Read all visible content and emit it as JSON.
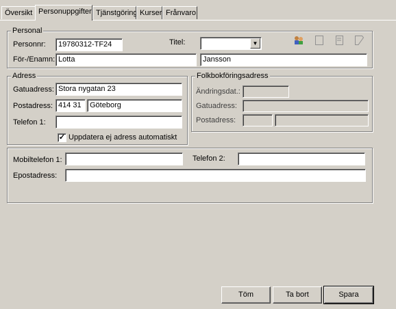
{
  "tabs": [
    {
      "label": "Översikt",
      "active": false
    },
    {
      "label": "Personuppgifter",
      "active": true
    },
    {
      "label": "Tjänstgöring",
      "active": false
    },
    {
      "label": "Kurser",
      "active": false
    },
    {
      "label": "Frånvaro",
      "active": false
    }
  ],
  "personal": {
    "legend": "Personal",
    "personnr_label": "Personnr:",
    "personnr_value": "19780312-TF24",
    "titel_label": "Titel:",
    "titel_value": "",
    "name_label": "För-/Enamn:",
    "first_name": "Lotta",
    "last_name": "Jansson",
    "toolbar_icons": [
      "people-icon",
      "blank-page-icon",
      "document-icon",
      "note-icon"
    ]
  },
  "adress": {
    "legend": "Adress",
    "gatuadress_label": "Gatuadress:",
    "gatuadress_value": "Stora nygatan 23",
    "postadress_label": "Postadress:",
    "postnummer_value": "414 31",
    "postort_value": "Göteborg",
    "telefon1_label": "Telefon 1:",
    "telefon1_value": "",
    "checkbox_label": "Uppdatera ej adress automatiskt",
    "checkbox_checked": true
  },
  "folkbokforing": {
    "legend": "Folkbokföringsadress",
    "andringsdat_label": "Ändringsdat.:",
    "gatuadress_label": "Gatuadress:",
    "postadress_label": "Postadress:"
  },
  "contact": {
    "mobil_label": "Mobiltelefon 1:",
    "mobil_value": "",
    "telefon2_label": "Telefon 2:",
    "telefon2_value": "",
    "epost_label": "Epostadress:",
    "epost_value": ""
  },
  "buttons": {
    "tom": "Töm",
    "ta_bort": "Ta bort",
    "spara": "Spara"
  },
  "colors": {
    "background": "#d4d0c8",
    "field": "#ffffff"
  }
}
